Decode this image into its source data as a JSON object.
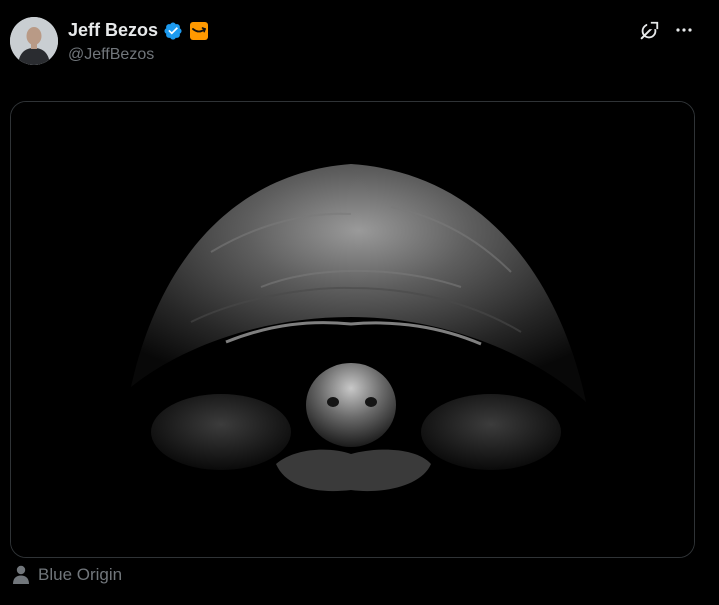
{
  "author": {
    "display_name": "Jeff Bezos",
    "handle": "@JeffBezos",
    "verified": true,
    "affiliation_icon": "amazon-logo"
  },
  "toolbar": {
    "grok_icon": "grok-icon",
    "more_icon": "more-icon"
  },
  "media": {
    "type": "photo",
    "subject_icon": "tortoise-photo"
  },
  "tagged": {
    "icon": "person-icon",
    "label": "Blue Origin"
  },
  "colors": {
    "background": "#000000",
    "text_primary": "#e7e9ea",
    "text_secondary": "#71767b",
    "verified_blue": "#1d9bf0",
    "affiliation_orange": "#ff9900",
    "border": "#2f3336"
  }
}
